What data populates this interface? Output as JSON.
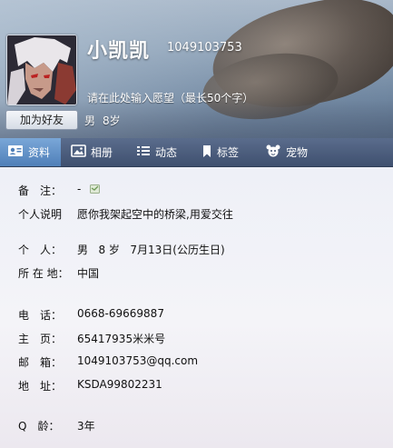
{
  "profile": {
    "nickname": "小凯凯",
    "qq_number": "1049103753",
    "wish_placeholder": "请在此处输入愿望（最长50个字）",
    "gender": "男",
    "age": "8岁",
    "add_friend_label": "加为好友"
  },
  "tabs": [
    {
      "label": "资料",
      "icon": "id-card-icon",
      "active": true
    },
    {
      "label": "相册",
      "icon": "photo-icon"
    },
    {
      "label": "动态",
      "icon": "feed-list-icon"
    },
    {
      "label": "标签",
      "icon": "bookmark-icon"
    },
    {
      "label": "宠物",
      "icon": "pet-icon"
    }
  ],
  "info": {
    "remark": {
      "label": "备　注：",
      "value": "-"
    },
    "description": {
      "label": "个人说明",
      "value": "愿你我架起空中的桥梁,用爱交往"
    },
    "personal": {
      "label": "个　人：",
      "gender": "男",
      "age": "8 岁",
      "birthday": "7月13日(公历生日)"
    },
    "location": {
      "label": "所 在 地：",
      "value": "中国"
    },
    "phone": {
      "label": "电　话：",
      "value": "0668-69669887"
    },
    "homepage": {
      "label": "主　页：",
      "value": "65417935米米号"
    },
    "email": {
      "label": "邮　箱：",
      "value": "1049103753@qq.com"
    },
    "address": {
      "label": "地　址：",
      "value": "KSDA99802231"
    },
    "qq_age": {
      "label": "Q　龄：",
      "value": "3年"
    }
  },
  "colors": {
    "tabbar": "#3f506f",
    "tab_active": "#4f7fb8",
    "content_bg": "#eef0f7"
  }
}
